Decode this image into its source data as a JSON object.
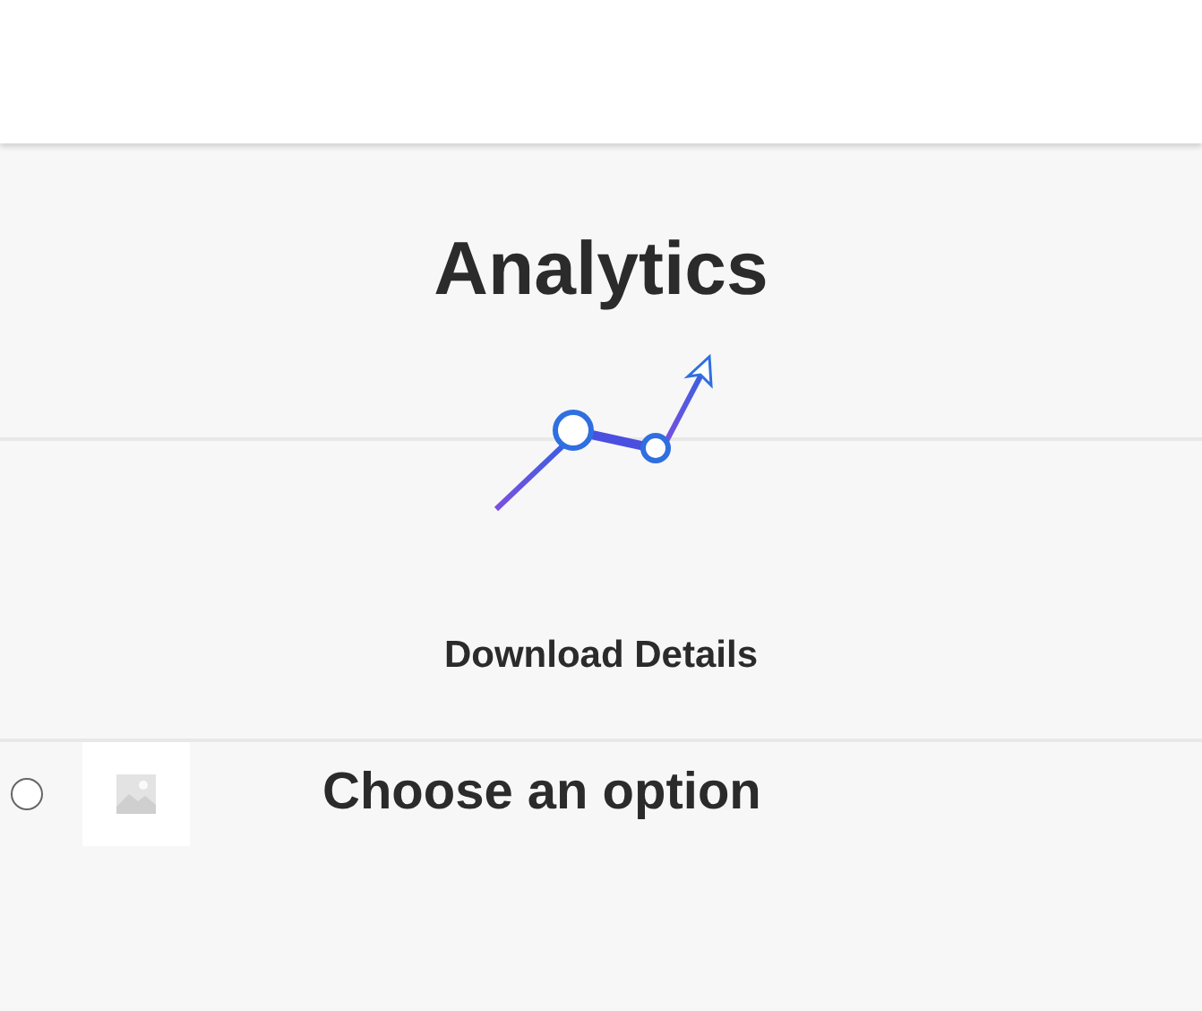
{
  "title": "Analytics",
  "action": {
    "label": "Download Details"
  },
  "options": [
    {
      "label": "Choose an option",
      "selected": false
    }
  ]
}
